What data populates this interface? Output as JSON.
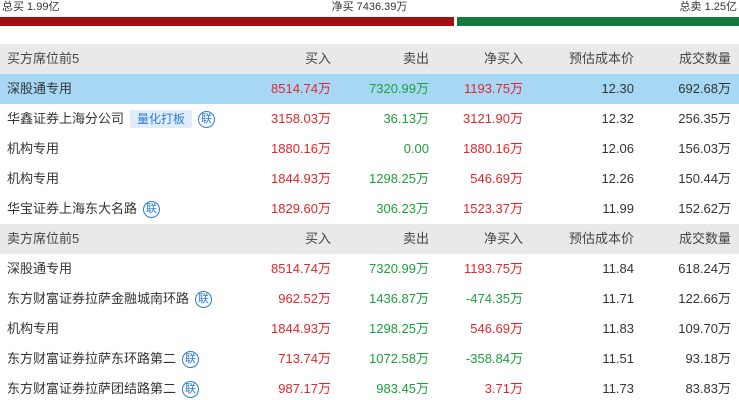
{
  "summary": {
    "total_buy": "总买 1.99亿",
    "net_buy": "净买 7436.39万",
    "total_sell": "总卖 1.25亿",
    "buy_ratio": 0.614
  },
  "colors": {
    "up": "#e3262a",
    "down": "#1f9e3c",
    "buy_bar": "#a40e0e",
    "sell_bar": "#137a3b",
    "highlight": "#a6d8f6",
    "accent": "#2b7bd6"
  },
  "icons": {
    "lian": "联"
  },
  "tags": {
    "quant": "量化打板"
  },
  "buy_section": {
    "headers": [
      "买方席位前5",
      "买入",
      "卖出",
      "净买入",
      "预估成本价",
      "成交数量"
    ],
    "rows": [
      {
        "name": "深股通专用",
        "buy": "8514.74万",
        "sell": "7320.99万",
        "net": "1193.75万",
        "net_sign": "up",
        "cost": "12.30",
        "vol": "692.68万",
        "tag": false,
        "lian": false,
        "highlight": true
      },
      {
        "name": "华鑫证券上海分公司",
        "buy": "3158.03万",
        "sell": "36.13万",
        "net": "3121.90万",
        "net_sign": "up",
        "cost": "12.32",
        "vol": "256.35万",
        "tag": true,
        "lian": true,
        "highlight": false
      },
      {
        "name": "机构专用",
        "buy": "1880.16万",
        "sell": "0.00",
        "net": "1880.16万",
        "net_sign": "up",
        "cost": "12.06",
        "vol": "156.03万",
        "tag": false,
        "lian": false,
        "highlight": false
      },
      {
        "name": "机构专用",
        "buy": "1844.93万",
        "sell": "1298.25万",
        "net": "546.69万",
        "net_sign": "up",
        "cost": "12.26",
        "vol": "150.44万",
        "tag": false,
        "lian": false,
        "highlight": false
      },
      {
        "name": "华宝证券上海东大名路",
        "buy": "1829.60万",
        "sell": "306.23万",
        "net": "1523.37万",
        "net_sign": "up",
        "cost": "11.99",
        "vol": "152.62万",
        "tag": false,
        "lian": true,
        "highlight": false
      }
    ]
  },
  "sell_section": {
    "headers": [
      "卖方席位前5",
      "买入",
      "卖出",
      "净买入",
      "预估成本价",
      "成交数量"
    ],
    "rows": [
      {
        "name": "深股通专用",
        "buy": "8514.74万",
        "sell": "7320.99万",
        "net": "1193.75万",
        "net_sign": "up",
        "cost": "11.84",
        "vol": "618.24万",
        "tag": false,
        "lian": false,
        "highlight": false
      },
      {
        "name": "东方财富证券拉萨金融城南环路",
        "buy": "962.52万",
        "sell": "1436.87万",
        "net": "-474.35万",
        "net_sign": "down",
        "cost": "11.71",
        "vol": "122.66万",
        "tag": false,
        "lian": true,
        "highlight": false
      },
      {
        "name": "机构专用",
        "buy": "1844.93万",
        "sell": "1298.25万",
        "net": "546.69万",
        "net_sign": "up",
        "cost": "11.83",
        "vol": "109.70万",
        "tag": false,
        "lian": false,
        "highlight": false
      },
      {
        "name": "东方财富证券拉萨东环路第二",
        "buy": "713.74万",
        "sell": "1072.58万",
        "net": "-358.84万",
        "net_sign": "down",
        "cost": "11.51",
        "vol": "93.18万",
        "tag": false,
        "lian": true,
        "highlight": false
      },
      {
        "name": "东方财富证券拉萨团结路第二",
        "buy": "987.17万",
        "sell": "983.45万",
        "net": "3.71万",
        "net_sign": "up",
        "cost": "11.73",
        "vol": "83.83万",
        "tag": false,
        "lian": true,
        "highlight": false
      }
    ]
  }
}
